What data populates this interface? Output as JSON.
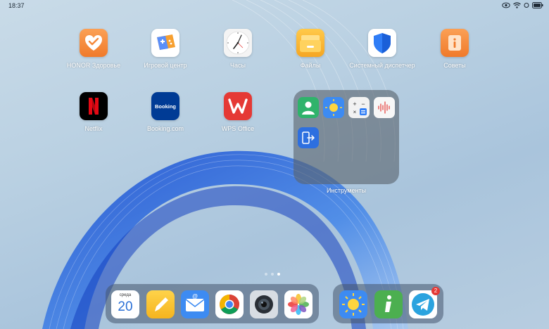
{
  "status_bar": {
    "time": "18:37",
    "icons": [
      "eye-comfort-icon",
      "wifi-icon",
      "signal-icon",
      "battery-icon"
    ]
  },
  "apps": [
    {
      "name": "HONOR Здоровье",
      "icon": "health-heart-icon",
      "color": "#f5883a"
    },
    {
      "name": "Игровой центр",
      "icon": "game-center-icon",
      "color": "#ffffff"
    },
    {
      "name": "Часы",
      "icon": "clock-icon",
      "color": "#ffffff"
    },
    {
      "name": "Файлы",
      "icon": "files-folder-icon",
      "color": "#f7b733"
    },
    {
      "name": "Системный диспетчер",
      "icon": "shield-icon",
      "color": "#ffffff"
    },
    {
      "name": "Советы",
      "icon": "tips-icon",
      "color": "#f5883a"
    },
    {
      "name": "Netflix",
      "icon": "netflix-icon",
      "color": "#000000"
    },
    {
      "name": "Booking.com",
      "icon": "booking-icon",
      "color": "#003b95"
    },
    {
      "name": "WPS Office",
      "icon": "wps-office-icon",
      "color": "#e53935"
    }
  ],
  "folder": {
    "name": "Инструменты",
    "items": [
      "contacts-icon",
      "weather-icon",
      "calculator-icon",
      "voice-recorder-icon",
      "phone-clone-icon"
    ]
  },
  "page_indicator": {
    "count": 3,
    "active": 3
  },
  "dock_left": [
    {
      "icon": "calendar-icon",
      "weekday": "среда",
      "day": "20"
    },
    {
      "icon": "notes-icon"
    },
    {
      "icon": "email-icon"
    },
    {
      "icon": "chrome-icon"
    },
    {
      "icon": "camera-icon"
    },
    {
      "icon": "gallery-icon"
    }
  ],
  "dock_right": [
    {
      "icon": "weather-icon"
    },
    {
      "icon": "info-icon"
    },
    {
      "icon": "telegram-icon",
      "badge": "2"
    }
  ]
}
